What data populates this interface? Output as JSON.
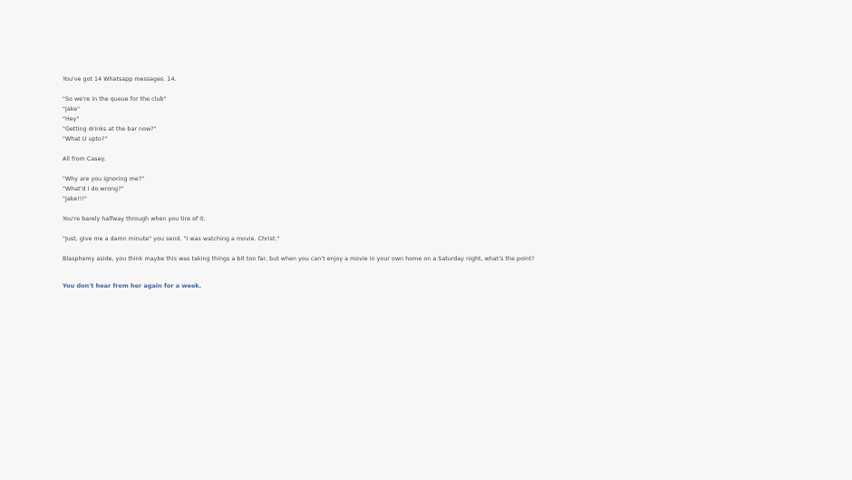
{
  "colors": {
    "background": "#f7f7f7",
    "text": "#3f3f3f",
    "link": "#3f62a6"
  },
  "story": {
    "intro": "You've got 14 Whatsapp messages. 14.",
    "messages_1": [
      "\"So we're in the queue for the club\"",
      "\"Jake\"",
      "\"Hey\"",
      "\"Getting drinks at the bar now?\"",
      "\"What U upto?\""
    ],
    "from_line": "All from Casey.",
    "messages_2": [
      "\"Why are you ignoring me?\"",
      "\"What'd I do wrong?\"",
      "\"Jake!!!\""
    ],
    "halfway": "You're barely halfway through when you tire of it.",
    "reply": "\"Just, give me a damn minute\" you send. \"I was watching a movie. Christ.\"",
    "blasphemy": "Blasphemy aside, you think maybe this was taking things a bit too far, but when you can't enjoy a movie in your own home on a Saturday night, what's the point?",
    "choice_link": "You don't hear from her again for a week."
  }
}
